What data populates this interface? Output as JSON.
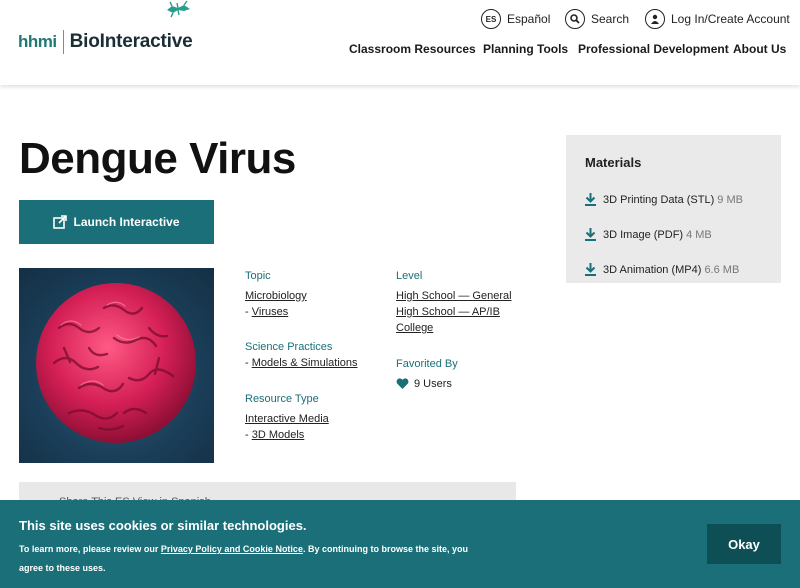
{
  "header": {
    "logo_hhmi": "hhmi",
    "logo_brand": "BioInteractive",
    "utility": {
      "es_icon_text": "ES",
      "espanol": "Español",
      "search": "Search",
      "login": "Log In/Create Account"
    },
    "nav": [
      "Classroom Resources",
      "Planning Tools",
      "Professional Development",
      "About Us"
    ]
  },
  "page": {
    "title": "Dengue Virus",
    "launch_label": "Launch Interactive"
  },
  "meta": {
    "topic_label": "Topic",
    "topic": [
      "Microbiology",
      "Viruses"
    ],
    "practice_label": "Science Practices",
    "practice": "Models & Simulations",
    "rtype_label": "Resource Type",
    "rtype": [
      "Interactive Media",
      "3D Models"
    ],
    "level_label": "Level",
    "levels": [
      "High School — General",
      "High School — AP/IB",
      "College"
    ],
    "fav_label": "Favorited By",
    "fav_count": "9 Users",
    "dash": "- "
  },
  "materials": {
    "title": "Materials",
    "items": [
      {
        "name": "3D Printing Data (STL)",
        "size": "9 MB"
      },
      {
        "name": "3D Image (PDF)",
        "size": "4 MB"
      },
      {
        "name": "3D Animation (MP4)",
        "size": "6.6 MB"
      }
    ]
  },
  "share": {
    "text": "Share This     ES  View in Spanish"
  },
  "cookie": {
    "heading": "This site uses cookies or similar technologies.",
    "text_before": "To learn more, please review our ",
    "link": "Privacy Policy and Cookie Notice",
    "text_after": ". By continuing to browse the site, you agree to these uses.",
    "okay": "Okay"
  },
  "colors": {
    "accent": "#1b6f78",
    "button_dark": "#0d4f55",
    "panel_gray": "#eaeaea"
  }
}
